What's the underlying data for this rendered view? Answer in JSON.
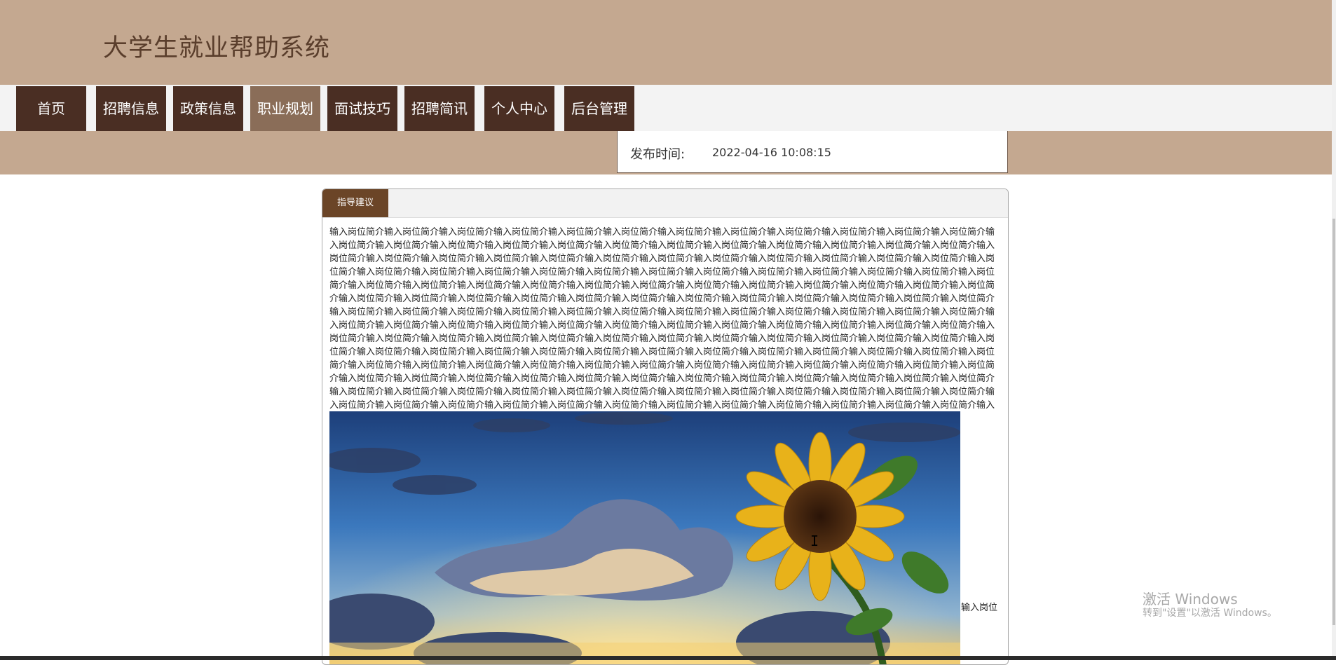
{
  "site": {
    "title": "大学生就业帮助系统"
  },
  "nav": {
    "items": [
      {
        "label": "首页"
      },
      {
        "label": "招聘信息"
      },
      {
        "label": "政策信息"
      },
      {
        "label": "职业规划"
      },
      {
        "label": "面试技巧"
      },
      {
        "label": "招聘简讯"
      },
      {
        "label": "个人中心"
      },
      {
        "label": "后台管理"
      }
    ],
    "active": "职业规划"
  },
  "article": {
    "publish_label": "发布时间:",
    "publish_time": "2022-04-16 10:08:15",
    "tab_label": "指导建议",
    "body_text": "输入岗位简介输入岗位简介输入岗位简介输入岗位简介输入岗位简介输入岗位简介输入岗位简介输入岗位简介输入岗位简介输入岗位简介输入岗位简介输入岗位简介输入岗位简介输入岗位简介输入岗位简介输入岗位简介输入岗位简介输入岗位简介输入岗位简介输入岗位简介输入岗位简介输入岗位简介输入岗位简介输入岗位简介输入岗位简介输入岗位简介输入岗位简介输入岗位简介输入岗位简介输入岗位简介输入岗位简介输入岗位简介输入岗位简介输入岗位简介输入岗位简介输入岗位简介输入岗位简介输入岗位简介输入岗位简介输入岗位简介输入岗位简介输入岗位简介输入岗位简介输入岗位简介输入岗位简介输入岗位简介输入岗位简介输入岗位简介输入岗位简介输入岗位简介输入岗位简介输入岗位简介输入岗位简介输入岗位简介输入岗位简介输入岗位简介输入岗位简介输入岗位简介输入岗位简介输入岗位简介输入岗位简介输入岗位简介输入岗位简介输入岗位简介输入岗位简介输入岗位简介输入岗位简介输入岗位简介输入岗位简介输入岗位简介输入岗位简介输入岗位简介输入岗位简介输入岗位简介输入岗位简介输入岗位简介输入岗位简介输入岗位简介输入岗位简介输入岗位简介输入岗位简介输入岗位简介输入岗位简介输入岗位简介输入岗位简介输入岗位简介输入岗位简介输入岗位简介输入岗位简介输入岗位简介输入岗位简介输入岗位简介输入岗位简介输入岗位简介输入岗位简介输入岗位简介输入岗位简介输入岗位简介输入岗位简介输入岗位简介输入岗位简介输入岗位简介输入岗位简介输入岗位简介输入岗位简介输入岗位简介输入岗位简介输入岗位简介输入岗位简介输入岗位简介输入岗位简介输入岗位简介输入岗位简介输入岗位简介输入岗位简介输入岗位简介输入岗位简介输入岗位简介输入岗位简介输入岗位简介输入岗位简介输入岗位简介输入岗位简介输入岗位简介输入岗位简介输入岗位简介输入岗位简介输入岗位简介输入岗位简介输入岗位简介输入岗位简介输入岗位简介输入岗位简介输入岗位简介输入岗位简介输入岗位简介输入岗位简介输入岗位简介输入岗位简介输入岗位简介输入岗位简介输入岗位简介输入岗位简介输入岗位简介输入岗位简介输入岗位简介输入岗位简介输入岗位简介输入岗位简介输入岗位简介输入岗位简介输入岗位简介输入岗位简介输入岗位简介输入岗位简介输入岗位简介输入岗位简介输入岗位简介输入岗位简介输入岗位简介输入岗位简介输入岗位简介输入岗位简介输入岗位简介输入岗位简介输入岗位简介输入岗位简介输入岗位简介输入岗位简介输入岗位简介输入岗位简介输入岗位简介输入岗位简介输入岗位简介输入岗位简介输入岗位简介输入岗位简介输入岗位简介输入岗位简介输入岗位简介输入岗位简介输入岗位简介输入岗位简介输入岗位简介输入岗位简介输入岗位简介输入岗位简介输入岗位简介输入岗位简介输入岗位简介输入岗位简介输入岗位简介输入岗位简介输入岗位简介输入岗位简介输入岗位简介输入岗位",
    "trailing_text": "输入岗位"
  },
  "os": {
    "watermark_title": "激活 Windows",
    "watermark_subtitle": "转到\"设置\"以激活 Windows。"
  },
  "colors": {
    "header_bg": "#c4a890",
    "nav_bg": "#4a2e23",
    "nav_active_bg": "#8a6d58",
    "tab_bg": "#6b4527",
    "title_text": "#5a3e2c"
  }
}
